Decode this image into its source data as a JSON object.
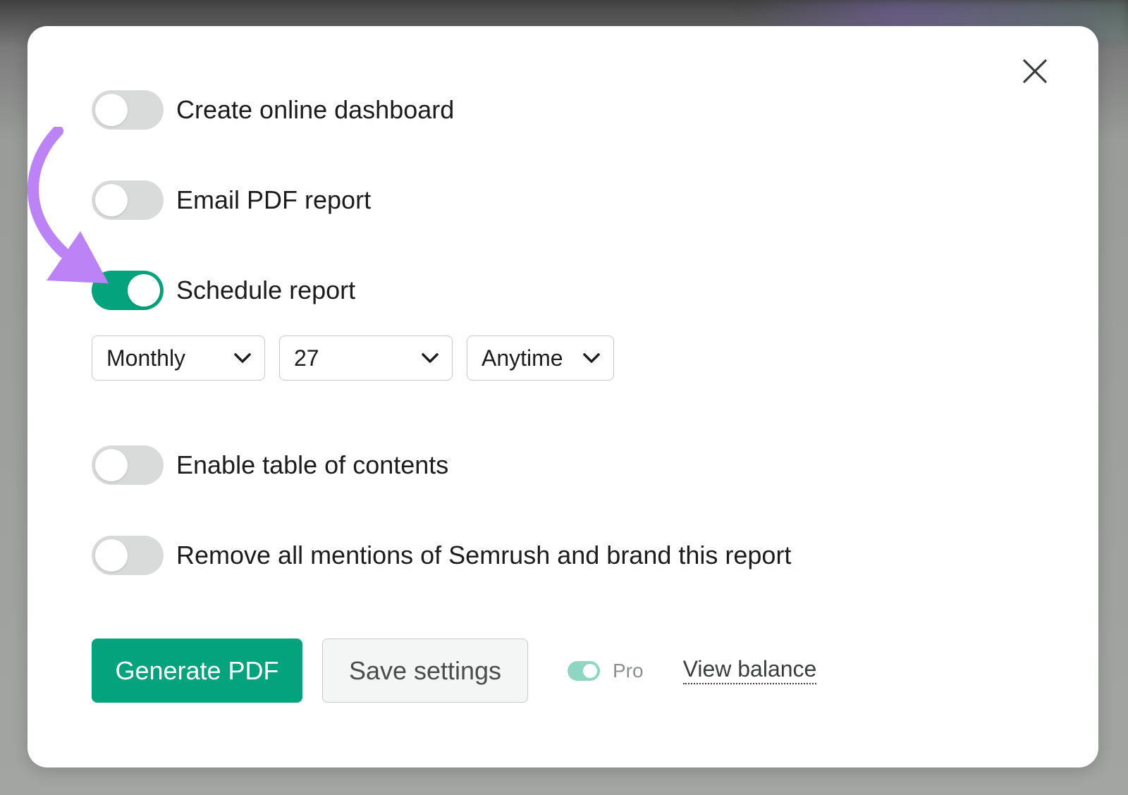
{
  "options": [
    {
      "label": "Create online dashboard",
      "on": false
    },
    {
      "label": "Email PDF report",
      "on": false
    },
    {
      "label": "Schedule report",
      "on": true
    },
    {
      "label": "Enable table of contents",
      "on": false
    },
    {
      "label": "Remove all mentions of Semrush and brand this report",
      "on": false
    }
  ],
  "schedule": {
    "frequency": "Monthly",
    "day": "27",
    "time": "Anytime"
  },
  "footer": {
    "generate_label": "Generate PDF",
    "save_label": "Save settings",
    "pro_label": "Pro",
    "balance_link": "View balance"
  },
  "icons": {
    "close": "close-icon",
    "dropdown": "chevron-down-icon",
    "annotation": "arrow-annotation-icon"
  },
  "colors": {
    "accent": "#04a37e",
    "toggle_off": "#d9dada",
    "annotation": "#bb83f5"
  }
}
